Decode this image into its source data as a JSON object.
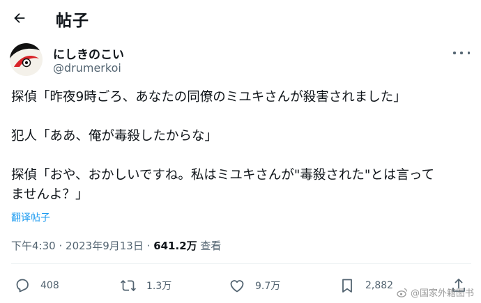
{
  "header": {
    "title": "帖子",
    "back_icon": "arrow-left-icon"
  },
  "author": {
    "display_name": "にしきのこい",
    "handle": "@drumerkoi",
    "avatar_icon": "koi-fish-avatar"
  },
  "tweet": {
    "lines": [
      "探偵「昨夜9時ごろ、あなたの同僚のミユキさんが殺害されました」",
      "",
      "犯人「ああ、俺が毒殺したからな」",
      "",
      "探偵「おや、おかしいですね。私はミユキさんが\"毒殺された\"とは言って",
      "ませんよ？」"
    ],
    "translate_label": "翻译帖子"
  },
  "meta": {
    "time": "下午4:30",
    "separator": "·",
    "date": "2023年9月13日",
    "views_count": "641.2万",
    "views_label": "查看"
  },
  "actions": {
    "reply_count": "408",
    "retweet_count": "1.3万",
    "like_count": "9.7万",
    "bookmark_count": "2,882"
  },
  "watermark": {
    "text": "@国家外籍图书"
  },
  "colors": {
    "accent": "#1d9bf0",
    "secondary_text": "#536471",
    "primary_text": "#0f1419"
  }
}
